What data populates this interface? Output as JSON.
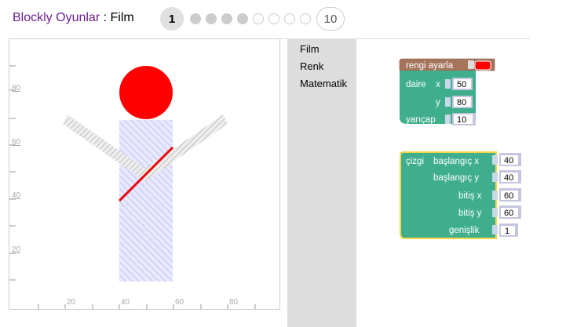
{
  "header": {
    "app_title": "Blockly Oyunlar",
    "separator": " : ",
    "game_name": "Film",
    "level_first": "1",
    "level_last": "10",
    "levels_completed_dots": 4,
    "levels_remaining_dots": 4
  },
  "stage": {
    "y_ticks": [
      "80",
      "60",
      "40",
      "20"
    ],
    "x_ticks": [
      "20",
      "40",
      "60",
      "80"
    ]
  },
  "toolbox": {
    "categories": [
      "Film",
      "Renk",
      "Matematik"
    ]
  },
  "blocks": {
    "color_block": {
      "label": "rengi ayarla",
      "color": "#ff0000"
    },
    "circle_block": {
      "label": "daire",
      "x_label": "x",
      "x_value": "50",
      "y_label": "y",
      "y_value": "80",
      "r_label": "yarıçap",
      "r_value": "10"
    },
    "line_block": {
      "label": "çizgi",
      "x1_label": "başlangıç x",
      "x1_value": "40",
      "y1_label": "başlangıç y",
      "y1_value": "40",
      "x2_label": "bitiş x",
      "x2_value": "60",
      "y2_label": "bitiş y",
      "y2_value": "60",
      "w_label": "genişlik",
      "w_value": "1"
    }
  },
  "colors": {
    "block_green": "#3fae8c",
    "block_brown": "#a5745b",
    "drawing_red": "#ff0000"
  }
}
